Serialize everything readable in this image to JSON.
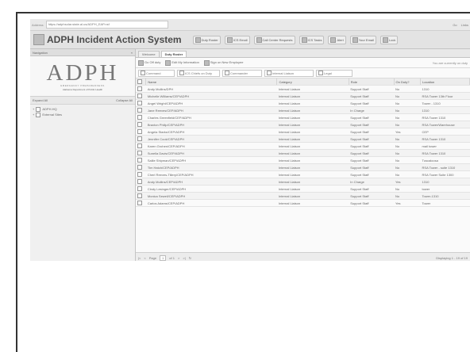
{
  "browser": {
    "address_label": "Address",
    "url": "https://adphsolar.state.al.us/ADPH_EAP.nsf",
    "go_label": "Go",
    "links_label": "Links"
  },
  "app": {
    "title": "ADPH Incident Action System",
    "toolbar": [
      {
        "label": "Duty Roster"
      },
      {
        "label": "ICS Email"
      },
      {
        "label": "Call Center Requests"
      },
      {
        "label": "ICS Tasks"
      },
      {
        "label": "Alert"
      },
      {
        "label": "Your Email"
      },
      {
        "label": "Lock"
      }
    ]
  },
  "nav": {
    "title": "Navigation",
    "logo_text": "ADPH",
    "logo_sub": "EMERGENCY PREPAREDNESS",
    "logo_sub2": "Alabama Department of Public Health",
    "expand_all": "Expand All",
    "collapse_all": "Collapse All",
    "tree": [
      "ADPH.HQ",
      "External Sites"
    ]
  },
  "main": {
    "tabs": [
      {
        "label": "Welcome"
      },
      {
        "label": "Duty Roster"
      }
    ],
    "actions": [
      {
        "label": "Go Off duty"
      },
      {
        "label": "Edit My Information"
      },
      {
        "label": "Sign on New Employee"
      }
    ],
    "status_note": "You are currently on duty",
    "filters": [
      {
        "label": "Command"
      },
      {
        "label": "ICS Chiefs on Duty"
      },
      {
        "label": "Commander"
      },
      {
        "label": "Internal Liaison"
      },
      {
        "label": "Legal"
      }
    ],
    "columns": [
      "Name",
      "Category",
      "Role",
      "On Duty?",
      "Location"
    ],
    "rows": [
      {
        "name": "Andy Mullins/DPH",
        "category": "Internal Liaison",
        "role": "Support Staff",
        "on_duty": "No",
        "location": "1310"
      },
      {
        "name": "Michelle Williams/CEP/ADPH",
        "category": "Internal Liaison",
        "role": "Support Staff",
        "on_duty": "No",
        "location": "RSA Tower 13th Floor"
      },
      {
        "name": "Angel Wright/CEP/ADPH",
        "category": "Internal Liaison",
        "role": "Support Staff",
        "on_duty": "No",
        "location": "Tower - 1310"
      },
      {
        "name": "Jane Reeves/CEP/ADPH",
        "category": "Internal Liaison",
        "role": "In Charge",
        "on_duty": "No",
        "location": "1310"
      },
      {
        "name": "Charles Greenfield/CEP/ADPH",
        "category": "Internal Liaison",
        "role": "Support Staff",
        "on_duty": "No",
        "location": "RSA Tower 1310"
      },
      {
        "name": "Braxton Philip/CEP/ADPH",
        "category": "Internal Liaison",
        "role": "Support Staff",
        "on_duty": "No",
        "location": "RSA Tower/Warehouse"
      },
      {
        "name": "Angela Starks/CEP/ADPH",
        "category": "Internal Liaison",
        "role": "Support Staff",
        "on_duty": "Yes",
        "location": "CEP"
      },
      {
        "name": "Jennifer Cook/CEP/ADPH",
        "category": "Internal Liaison",
        "role": "Support Staff",
        "on_duty": "No",
        "location": "RSA Tower 1310"
      },
      {
        "name": "Karen Grohen/CEP/ADPH",
        "category": "Internal Liaison",
        "role": "Support Staff",
        "on_duty": "No",
        "location": "mail tower"
      },
      {
        "name": "Sunella Davis/CEP/ADPH",
        "category": "Internal Liaison",
        "role": "Support Staff",
        "on_duty": "No",
        "location": "RSA Tower 1310"
      },
      {
        "name": "Sallie Shipman/CEP/ADPH",
        "category": "Internal Liaison",
        "role": "Support Staff",
        "on_duty": "No",
        "location": "Tuscaloosa"
      },
      {
        "name": "Tim Hatch/CEP/ADPH",
        "category": "Internal Liaison",
        "role": "Support Staff",
        "on_duty": "No",
        "location": "RSA Tower - suite 1310"
      },
      {
        "name": "Cheri Reeves-Tillery/CEP/ADPH",
        "category": "Internal Liaison",
        "role": "Support Staff",
        "on_duty": "No",
        "location": "RSA Tower Suite 1300"
      },
      {
        "name": "Andy Mullins/CEP/ADPH",
        "category": "Internal Liaison",
        "role": "In Charge",
        "on_duty": "Yes",
        "location": "1310"
      },
      {
        "name": "Cindy Lesinger/CEP/ADPH",
        "category": "Internal Liaison",
        "role": "Support Staff",
        "on_duty": "No",
        "location": "tower"
      },
      {
        "name": "Monica Sewell/CEP/ADPH",
        "category": "Internal Liaison",
        "role": "Support Staff",
        "on_duty": "No",
        "location": "Tower-1310"
      },
      {
        "name": "Carlos Adams/CEP/ADPH",
        "category": "Internal Liaison",
        "role": "Support Staff",
        "on_duty": "Yes",
        "location": "Tower"
      }
    ],
    "pager": {
      "page_label": "Page",
      "page_value": "1",
      "of_label": "of 1",
      "display_text": "Displaying 1 - 19 of 19"
    }
  }
}
